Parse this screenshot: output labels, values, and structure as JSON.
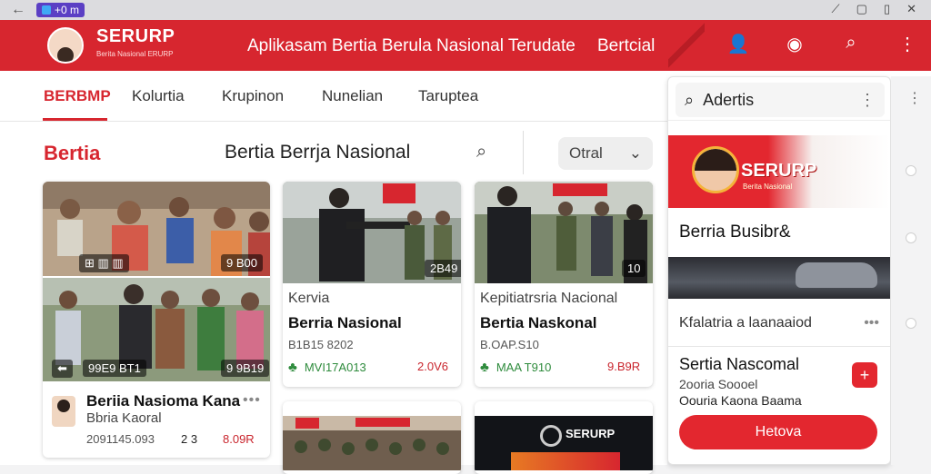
{
  "statusbar": {
    "chip": "+0 m"
  },
  "appbar": {
    "brand": "SERURP",
    "brand_sub": "Berita Nasional ERURP",
    "title": "Aplikasam Bertia Berula Nasional Terudate",
    "subtitle": "Bertcial"
  },
  "tabs": [
    "BERBMP",
    "Kolurtia",
    "Krupinon",
    "Nunelian",
    "Taruptea"
  ],
  "main": {
    "section_title": "Bertia",
    "section_center": "Bertia Berrja Nasional",
    "select_value": "Otral"
  },
  "cards": [
    {
      "overlay1": "9 B00",
      "overlay2": "99E9 BT1",
      "overlay3": "9 9B19",
      "title": "Beriia Nasioma Kana",
      "sub": "Bbria Kaoral",
      "meta": "2091145.093",
      "stat_a": "2 3",
      "stat_b": "8.09R"
    },
    {
      "overlay": "2B49",
      "kicker": "Kervia",
      "title": "Berria Nasional",
      "meta": "B1B15 8202",
      "stat_a": "MVI17A013",
      "stat_b": "2.0V6"
    },
    {
      "overlay": "10",
      "kicker": "Kepitiatrsria Nacional",
      "title": "Bertia Naskonal",
      "meta": "B.OAP.S10",
      "stat_a": "MAA T910",
      "stat_b": "9.B9R"
    },
    {
      "overlay": "SERURP"
    }
  ],
  "side": {
    "search_text": "Adertis",
    "banner_logo": "SERURP",
    "banner_sub": "Berita Nasional",
    "headline": "Berria Busibr&",
    "row": "Kfalatria a laanaaiod",
    "news_title": "Sertia Nascomal",
    "news_l1": "2ooria Soooel",
    "news_l2": "Oouria Kaona Baama",
    "cta": "Hetova"
  },
  "colors": {
    "accent": "#d7262f",
    "green": "#2e8b3c"
  }
}
